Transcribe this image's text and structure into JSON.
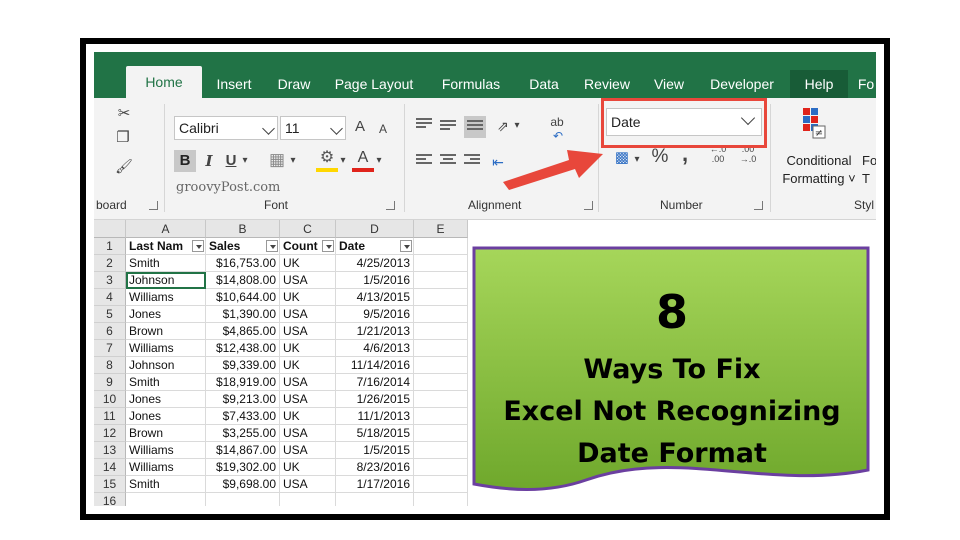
{
  "tabs": [
    "Home",
    "Insert",
    "Draw",
    "Page Layout",
    "Formulas",
    "Data",
    "Review",
    "View",
    "Developer",
    "Help",
    "Fo"
  ],
  "ribbon": {
    "font_name": "Calibri",
    "font_size": "11",
    "bold": "B",
    "italic": "I",
    "underline": "U",
    "grow_font": "A",
    "shrink_font": "A",
    "font_color": "A",
    "number_format": "Date",
    "percent": "%",
    "comma": ",",
    "inc_decimal_top": "←.0",
    "inc_decimal_bottom": ".00",
    "dec_decimal_top": ".00",
    "dec_decimal_bottom": "→.0",
    "wrap_text": "ab",
    "conditional_line1": "Conditional",
    "conditional_line2": "Formatting ˅",
    "fo_line1": "Fo",
    "fo_line2": "T",
    "groups": {
      "clipboard": "board",
      "font": "Font",
      "alignment": "Alignment",
      "number": "Number",
      "styles": "Styl"
    }
  },
  "watermark": "groovyPost.com",
  "sheet": {
    "columns": [
      "A",
      "B",
      "C",
      "D",
      "E"
    ],
    "header": [
      "Last Nam",
      "Sales",
      "Count",
      "Date"
    ],
    "rows": [
      [
        "Smith",
        "$16,753.00",
        "UK",
        "4/25/2013"
      ],
      [
        "Johnson",
        "$14,808.00",
        "USA",
        "1/5/2016"
      ],
      [
        "Williams",
        "$10,644.00",
        "UK",
        "4/13/2015"
      ],
      [
        "Jones",
        "$1,390.00",
        "USA",
        "9/5/2016"
      ],
      [
        "Brown",
        "$4,865.00",
        "USA",
        "1/21/2013"
      ],
      [
        "Williams",
        "$12,438.00",
        "UK",
        "4/6/2013"
      ],
      [
        "Johnson",
        "$9,339.00",
        "UK",
        "11/14/2016"
      ],
      [
        "Smith",
        "$18,919.00",
        "USA",
        "7/16/2014"
      ],
      [
        "Jones",
        "$9,213.00",
        "USA",
        "1/26/2015"
      ],
      [
        "Jones",
        "$7,433.00",
        "UK",
        "11/1/2013"
      ],
      [
        "Brown",
        "$3,255.00",
        "USA",
        "5/18/2015"
      ],
      [
        "Williams",
        "$14,867.00",
        "USA",
        "1/5/2015"
      ],
      [
        "Williams",
        "$19,302.00",
        "UK",
        "8/23/2016"
      ],
      [
        "Smith",
        "$9,698.00",
        "USA",
        "1/17/2016"
      ]
    ],
    "row_numbers": [
      "1",
      "2",
      "3",
      "4",
      "5",
      "6",
      "7",
      "8",
      "9",
      "10",
      "11",
      "12",
      "13",
      "14",
      "15",
      "16"
    ]
  },
  "card": {
    "number": "8",
    "line1": "Ways To Fix",
    "line2": "Excel Not Recognizing",
    "line3": "Date Format"
  },
  "colors": {
    "excel_green": "#217346",
    "highlight_red": "#e8473b",
    "card_green": "#8cc63f"
  }
}
